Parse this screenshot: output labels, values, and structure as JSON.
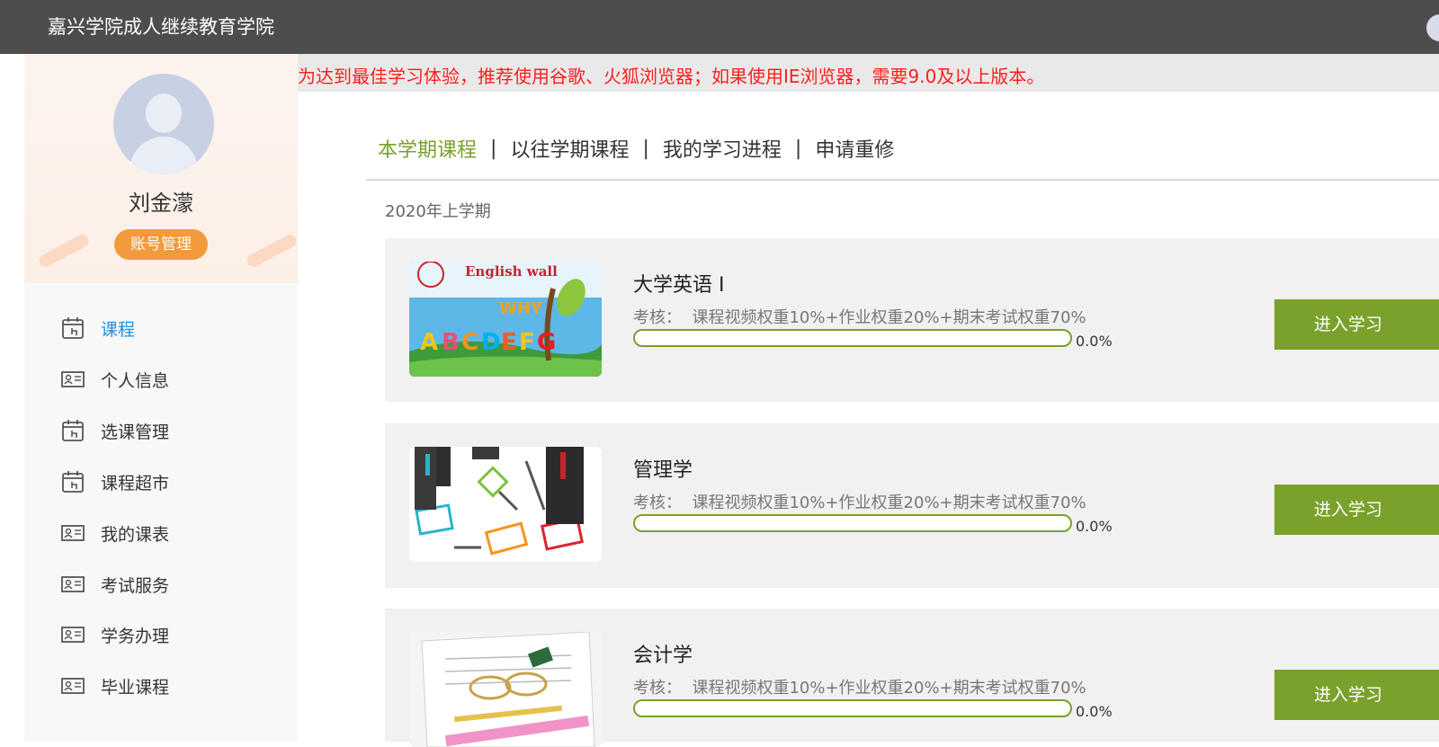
{
  "header": {
    "site_title": "嘉兴学院成人继续教育学院"
  },
  "notice": {
    "text": "为达到最佳学习体验，推荐使用谷歌、火狐浏览器；如果使用IE浏览器，需要9.0及以上版本。"
  },
  "profile": {
    "user_name": "刘金濛",
    "account_button": "账号管理"
  },
  "sidebar": {
    "items": [
      {
        "label": "课程",
        "icon": "calendar-icon",
        "active": true
      },
      {
        "label": "个人信息",
        "icon": "id-card-icon"
      },
      {
        "label": "选课管理",
        "icon": "calendar-icon"
      },
      {
        "label": "课程超市",
        "icon": "calendar-icon"
      },
      {
        "label": "我的课表",
        "icon": "id-card-icon"
      },
      {
        "label": "考试服务",
        "icon": "id-card-icon"
      },
      {
        "label": "学务办理",
        "icon": "id-card-icon"
      },
      {
        "label": "毕业课程",
        "icon": "id-card-icon"
      }
    ]
  },
  "tabs": [
    "本学期课程",
    "以往学期课程",
    "我的学习进程",
    "申请重修"
  ],
  "term": "2020年上学期",
  "courses": [
    {
      "name": "大学英语 I",
      "assess_label": "考核：",
      "assess_text": "课程视频权重10%+作业权重20%+期末考试权重70%",
      "progress": 0.0,
      "progress_text": "0.0%",
      "button": "进入学习",
      "thumb": "english-wall-illustration"
    },
    {
      "name": "管理学",
      "assess_label": "考核：",
      "assess_text": "课程视频权重10%+作业权重20%+期末考试权重70%",
      "progress": 0.0,
      "progress_text": "0.0%",
      "button": "进入学习",
      "thumb": "business-flowchart-illustration"
    },
    {
      "name": "会计学",
      "assess_label": "考核：",
      "assess_text": "课程视频权重10%+作业权重20%+期末考试权重70%",
      "progress": 0.0,
      "progress_text": "0.0%",
      "button": "进入学习",
      "thumb": "accounting-desk-illustration"
    }
  ],
  "colors": {
    "accent": "#7aa12b",
    "header_bg": "#4d4d4d",
    "notice_text": "#ff1f1f",
    "active_nav": "#1e8fe6",
    "account_button": "#f39a3c"
  }
}
